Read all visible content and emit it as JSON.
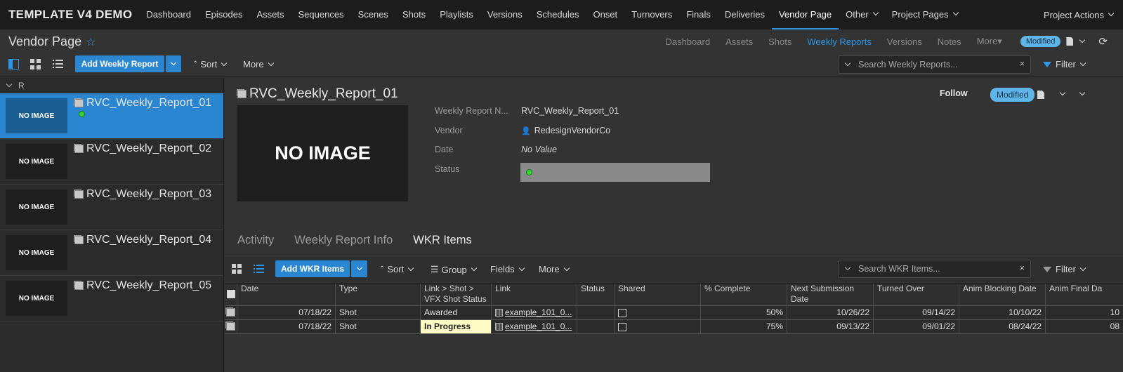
{
  "app": {
    "title": "TEMPLATE V4 DEMO"
  },
  "nav": {
    "items": [
      {
        "label": "Dashboard"
      },
      {
        "label": "Episodes"
      },
      {
        "label": "Assets"
      },
      {
        "label": "Sequences"
      },
      {
        "label": "Scenes"
      },
      {
        "label": "Shots"
      },
      {
        "label": "Playlists"
      },
      {
        "label": "Versions"
      },
      {
        "label": "Schedules"
      },
      {
        "label": "Onset"
      },
      {
        "label": "Turnovers"
      },
      {
        "label": "Finals"
      },
      {
        "label": "Deliveries"
      },
      {
        "label": "Vendor Page"
      },
      {
        "label": "Other"
      },
      {
        "label": "Project Pages"
      }
    ],
    "project_actions": "Project Actions"
  },
  "page": {
    "title": "Vendor Page",
    "tabs": [
      "Dashboard",
      "Assets",
      "Shots",
      "Weekly Reports",
      "Versions",
      "Notes",
      "More▾"
    ],
    "active_tab": "Weekly Reports",
    "badge": "Modified"
  },
  "toolbar": {
    "add_label": "Add Weekly Report",
    "sort_label": "Sort",
    "more_label": "More",
    "search_placeholder": "Search Weekly Reports...",
    "filter_label": "Filter"
  },
  "list": {
    "group_label": "R",
    "no_image": "NO IMAGE",
    "items": [
      {
        "title": "RVC_Weekly_Report_01"
      },
      {
        "title": "RVC_Weekly_Report_02"
      },
      {
        "title": "RVC_Weekly_Report_03"
      },
      {
        "title": "RVC_Weekly_Report_04"
      },
      {
        "title": "RVC_Weekly_Report_05"
      }
    ]
  },
  "detail": {
    "title": "RVC_Weekly_Report_01",
    "no_image": "NO IMAGE",
    "follow": "Follow",
    "badge": "Modified",
    "fields": {
      "name_label": "Weekly Report N...",
      "name_value": "RVC_Weekly_Report_01",
      "vendor_label": "Vendor",
      "vendor_value": "RedesignVendorCo",
      "date_label": "Date",
      "date_value": "No Value",
      "status_label": "Status"
    },
    "tabs": [
      "Activity",
      "Weekly Report Info",
      "WKR Items"
    ],
    "active_tab": "WKR Items"
  },
  "wkr": {
    "add_label": "Add WKR Items",
    "sort_label": "Sort",
    "group_label": "Group",
    "fields_label": "Fields",
    "more_label": "More",
    "search_placeholder": "Search WKR Items...",
    "filter_label": "Filter",
    "columns": [
      "Date",
      "Type",
      "Link > Shot > VFX Shot Status",
      "Link",
      "Status",
      "Shared",
      "% Complete",
      "Next Submission Date",
      "Turned Over",
      "Anim Blocking Date",
      "Anim Final Da"
    ],
    "rows": [
      {
        "date": "07/18/22",
        "type": "Shot",
        "vfx_status": "Awarded",
        "link": "example_101_0...",
        "status": "",
        "complete": "50%",
        "next_sub": "10/26/22",
        "turned_over": "09/14/22",
        "anim_blocking": "10/10/22",
        "anim_final": "10"
      },
      {
        "date": "07/18/22",
        "type": "Shot",
        "vfx_status": "In Progress",
        "link": "example_101_0...",
        "status": "",
        "complete": "75%",
        "next_sub": "09/13/22",
        "turned_over": "09/01/22",
        "anim_blocking": "08/24/22",
        "anim_final": "08"
      }
    ]
  },
  "colors": {
    "accent": "#2e96e6",
    "button": "#2a86d1",
    "status_green": "#35d435",
    "in_progress": "#fffbc4"
  }
}
